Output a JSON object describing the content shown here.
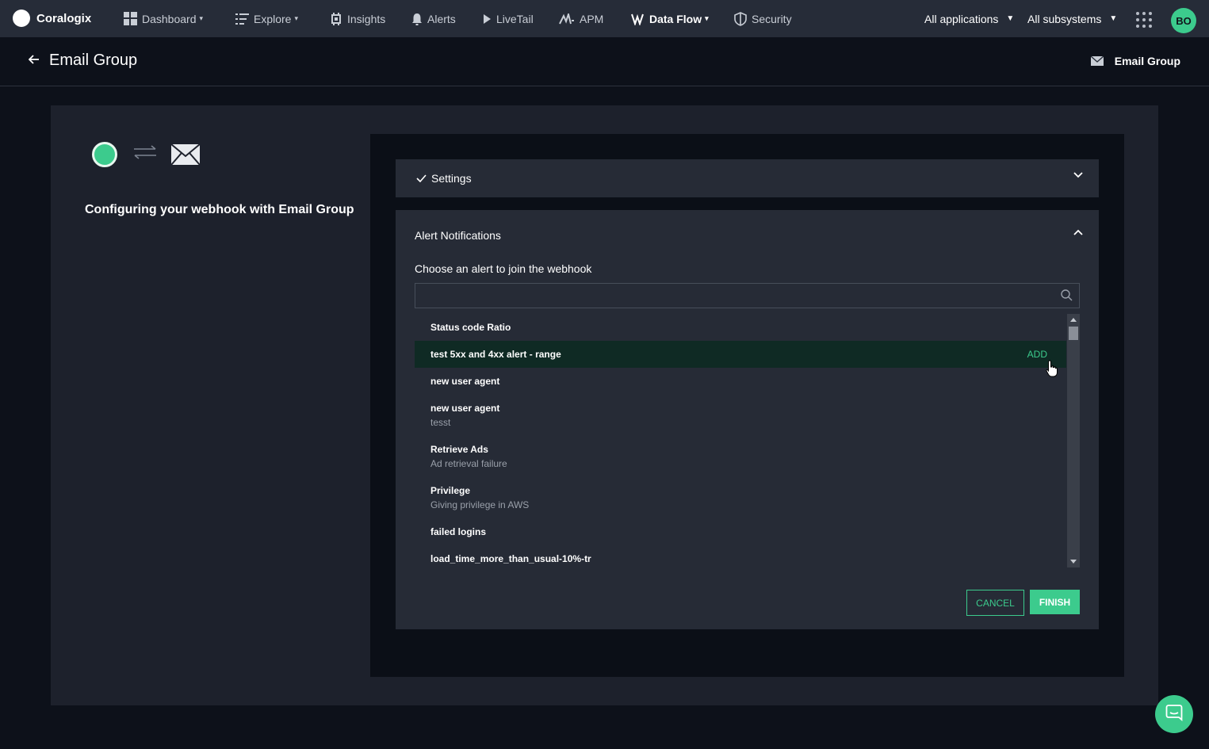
{
  "brand": {
    "name": "Coralogix"
  },
  "nav": [
    {
      "label": "Dashboard",
      "icon": "dashboard-icon",
      "caret": true
    },
    {
      "label": "Explore",
      "icon": "explore-icon",
      "caret": true
    },
    {
      "label": "Insights",
      "icon": "insights-icon",
      "caret": false
    },
    {
      "label": "Alerts",
      "icon": "bell-icon",
      "caret": false
    },
    {
      "label": "LiveTail",
      "icon": "play-icon",
      "caret": false
    },
    {
      "label": "APM",
      "icon": "apm-icon",
      "caret": false
    },
    {
      "label": "Data Flow",
      "icon": "data-flow-icon",
      "caret": true
    },
    {
      "label": "Security",
      "icon": "shield-icon",
      "caret": false
    }
  ],
  "filters": {
    "applications": "All applications",
    "subsystems": "All subsystems"
  },
  "user": {
    "initials": "BO"
  },
  "header": {
    "title": "Email Group",
    "integration_label": "Email Group"
  },
  "left": {
    "config_text": "Configuring your webhook with Email Group"
  },
  "settings": {
    "label": "Settings"
  },
  "alerts_panel": {
    "title": "Alert Notifications",
    "choose_label": "Choose an alert to join the webhook",
    "search_value": "",
    "search_placeholder": "",
    "add_label": "ADD",
    "items": [
      {
        "title": "Status code Ratio",
        "subtitle": ""
      },
      {
        "title": "test 5xx and 4xx alert - range",
        "subtitle": ""
      },
      {
        "title": "new user agent",
        "subtitle": ""
      },
      {
        "title": "new user agent",
        "subtitle": "tesst"
      },
      {
        "title": "Retrieve Ads",
        "subtitle": "Ad retrieval failure"
      },
      {
        "title": "Privilege",
        "subtitle": "Giving privilege in AWS"
      },
      {
        "title": "failed logins",
        "subtitle": ""
      },
      {
        "title": "load_time_more_than_usual-10%-tr",
        "subtitle": ""
      }
    ],
    "hovered_index": 1
  },
  "buttons": {
    "cancel": "CANCEL",
    "finish": "FINISH"
  },
  "colors": {
    "accent": "#3ccb8d",
    "nav_bg": "#262c38",
    "page_bg": "#0d111a",
    "card_bg": "#1d212c",
    "panel_bg": "#262b36"
  }
}
